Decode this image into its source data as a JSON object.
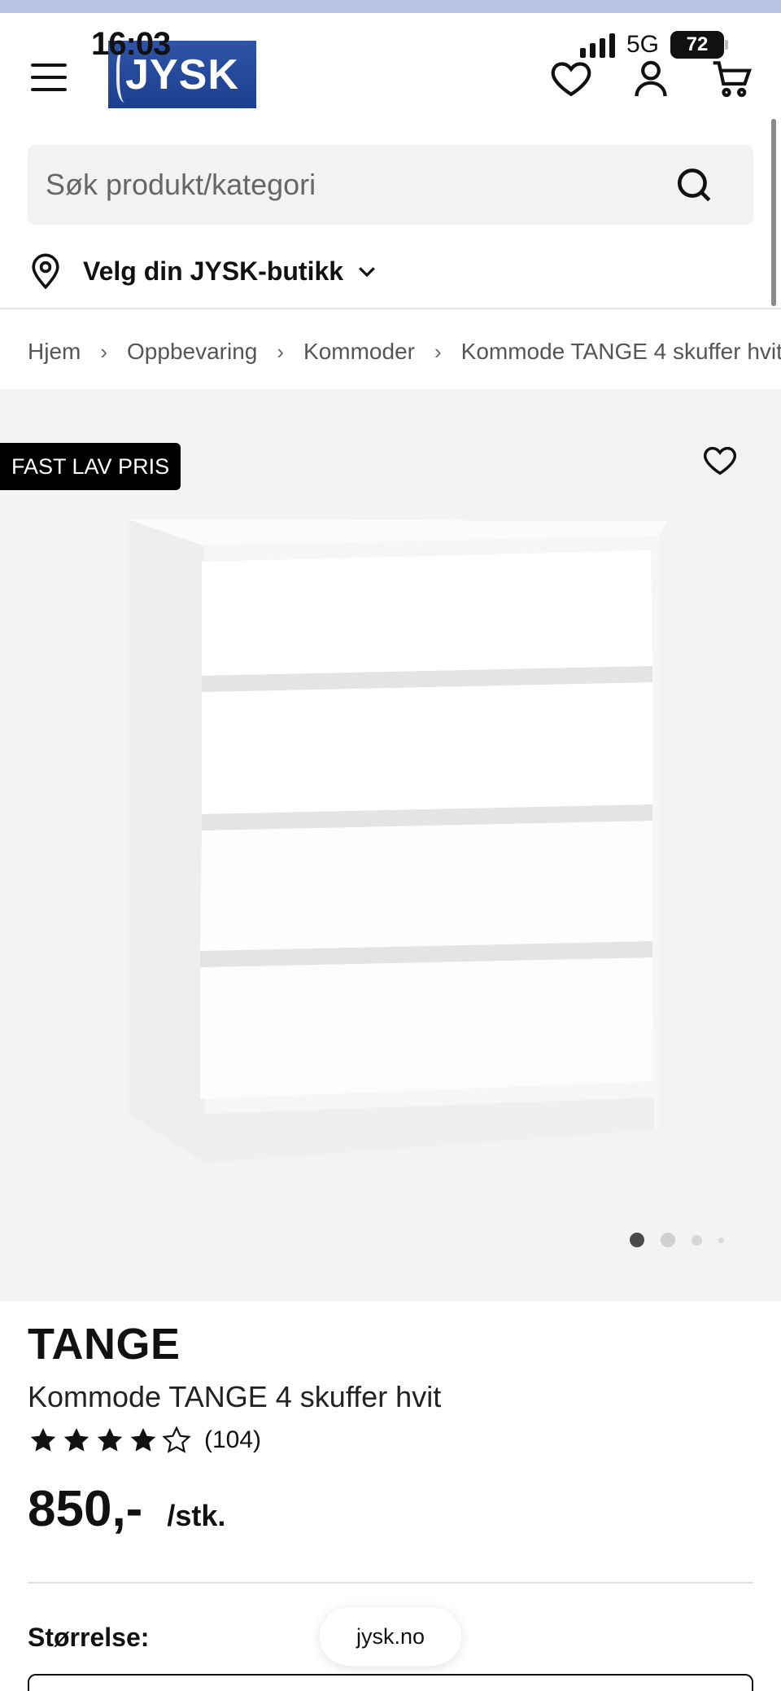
{
  "status_bar": {
    "time": "16:03",
    "network": "5G",
    "battery": "72"
  },
  "header": {
    "logo_text": "JYSK",
    "icons": [
      "menu-icon",
      "heart-icon",
      "user-icon",
      "cart-icon"
    ]
  },
  "search": {
    "placeholder": "Søk produkt/kategori",
    "value": ""
  },
  "store_picker": {
    "label": "Velg din JYSK-butikk"
  },
  "breadcrumb": [
    "Hjem",
    "Oppbevaring",
    "Kommoder",
    "Kommode TANGE 4 skuffer hvit"
  ],
  "product": {
    "badge": "FAST LAV PRIS",
    "brand": "TANGE",
    "name": "Kommode TANGE 4 skuffer hvit",
    "rating": 4,
    "rating_max": 5,
    "review_count": "(104)",
    "price": "850,-",
    "unit": "/stk.",
    "size_label": "Størrelse:",
    "image_count": 4,
    "active_image": 1
  },
  "browser": {
    "url": "jysk.no"
  },
  "colors": {
    "logo_blue": "#2f54a6",
    "badge_bg": "#000000",
    "image_bg": "#f3f3f3",
    "search_bg": "#f2f2f2"
  }
}
